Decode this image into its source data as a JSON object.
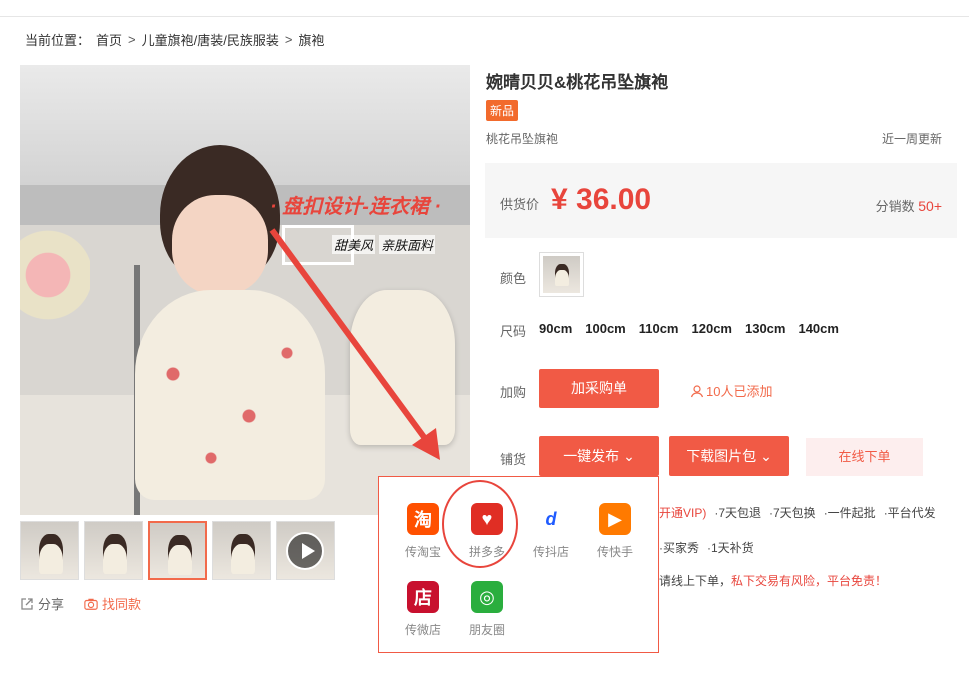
{
  "breadcrumb": {
    "prefix": "当前位置：",
    "items": [
      "首页",
      "儿童旗袍/唐装/民族服装",
      "旗袍"
    ],
    "separator": ">"
  },
  "main_image": {
    "banner": "· 盘扣设计-连衣裙 ·",
    "sub_text_1": "甜美风",
    "sub_text_2": "亲肤面料"
  },
  "thumbnails": {
    "count": 5,
    "active_index": 2,
    "last_is_video": true
  },
  "actions": {
    "share": "分享",
    "find_similar": "找同款"
  },
  "product": {
    "title": "婉晴贝贝&桃花吊坠旗袍",
    "badge": "新品",
    "subtitle": "桃花吊坠旗袍",
    "updated": "近一周更新"
  },
  "price": {
    "label": "供货价",
    "value": "¥ 36.00",
    "sold_label": "分销数",
    "sold_value": "50+"
  },
  "color": {
    "label": "颜色"
  },
  "size": {
    "label": "尺码",
    "options": [
      "90cm",
      "100cm",
      "110cm",
      "120cm",
      "130cm",
      "140cm"
    ]
  },
  "cart": {
    "label": "加购",
    "button": "加采购单",
    "added": "10人已添加"
  },
  "distribute": {
    "label": "铺货",
    "publish_button": "一键发布",
    "download_button": "下载图片包",
    "online_button": "在线下单"
  },
  "services": {
    "line1_partial": "开通VIP)",
    "line1_items": [
      "·7天包退",
      "·7天包换",
      "·一件起批",
      "·平台代发"
    ],
    "line2_items": [
      "·买家秀",
      "·1天补货"
    ],
    "line3_a": "请线上下单，",
    "line3_b": "私下交易有风险，平台免责！"
  },
  "publish_menu": [
    {
      "label": "传淘宝",
      "icon": "taobao-icon",
      "glyph": "淘",
      "color": "#ff5000"
    },
    {
      "label": "拼多多",
      "icon": "pinduoduo-icon",
      "glyph": "♡",
      "color": "#e02e24"
    },
    {
      "label": "传抖店",
      "icon": "douyin-store-icon",
      "glyph": "/d",
      "color": "#1f5bff"
    },
    {
      "label": "传快手",
      "icon": "kuaishou-icon",
      "glyph": "▶",
      "color": "#ff7a00"
    },
    {
      "label": "传微店",
      "icon": "weidian-icon",
      "glyph": "店",
      "color": "#c8102e"
    },
    {
      "label": "朋友圈",
      "icon": "moments-icon",
      "glyph": "◎",
      "color": "#2aae3e"
    }
  ],
  "colors": {
    "accent": "#f15a45",
    "price": "#e8453c",
    "badge": "#f26a2c"
  }
}
